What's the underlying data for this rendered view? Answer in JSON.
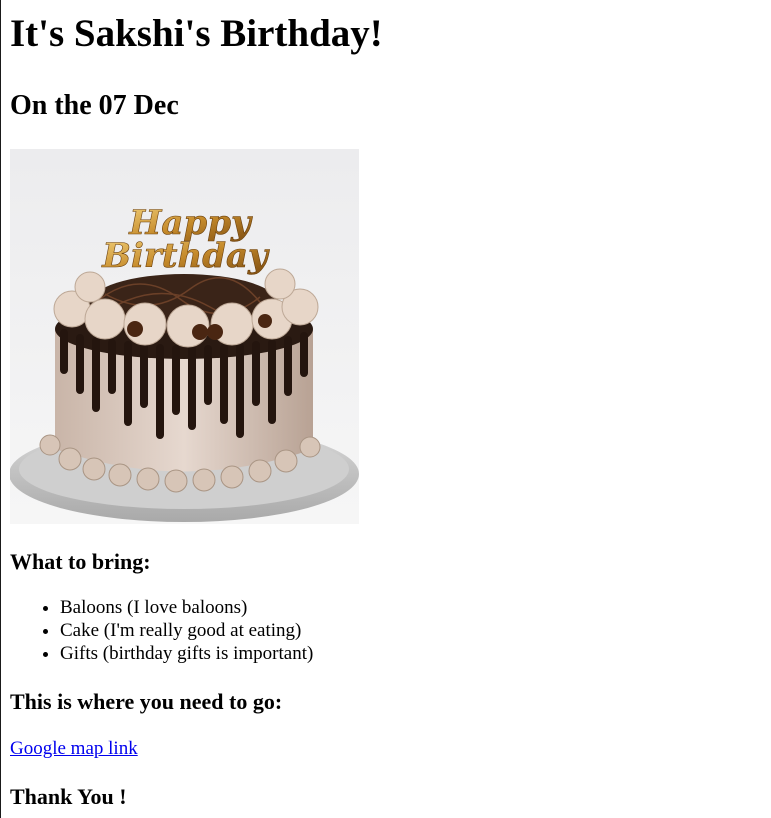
{
  "page": {
    "title": "It's Sakshi's Birthday!",
    "date_line": "On the 07 Dec"
  },
  "image": {
    "alt": "Birthday cake",
    "topper_text_line1": "Happy",
    "topper_text_line2": "Birthday"
  },
  "bring": {
    "heading": "What to bring:",
    "items": [
      "Baloons (I love baloons)",
      "Cake (I'm really good at eating)",
      "Gifts (birthday gifts is important)"
    ]
  },
  "location": {
    "heading": "This is where you need to go:",
    "link_text": "Google map link"
  },
  "closing": {
    "text": "Thank You !"
  },
  "colors": {
    "link": "#0000ee",
    "text": "#000000",
    "background": "#ffffff"
  }
}
